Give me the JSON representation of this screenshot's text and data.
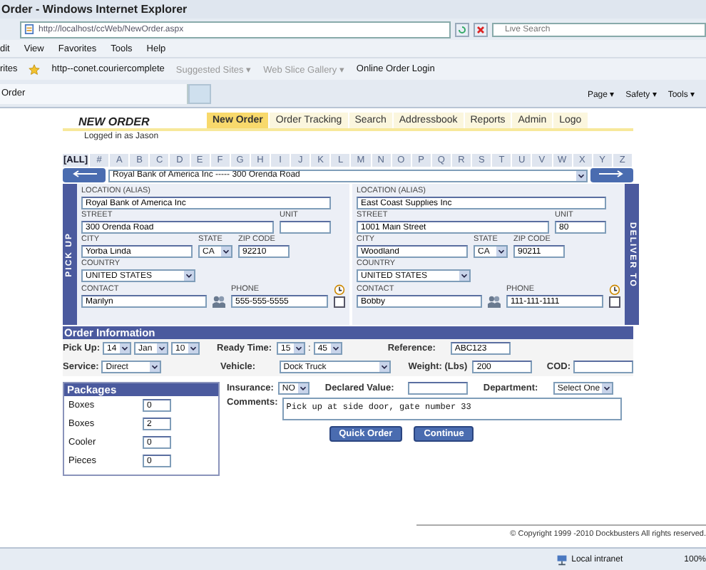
{
  "browser": {
    "title": "Order - Windows Internet Explorer",
    "address": "http://localhost/ccWeb/NewOrder.aspx",
    "search_placeholder": "Live Search",
    "menu": [
      "dit",
      "View",
      "Favorites",
      "Tools",
      "Help"
    ],
    "favorites_label": "rites",
    "favorites": [
      {
        "label": "http--conet.couriercomplete",
        "dimmed": false
      },
      {
        "label": "Suggested Sites ▾",
        "dimmed": true
      },
      {
        "label": "Web Slice Gallery ▾",
        "dimmed": true
      },
      {
        "label": "Online Order Login",
        "dimmed": false
      }
    ],
    "tab": "Order",
    "commands": [
      "Page ▾",
      "Safety ▾",
      "Tools ▾"
    ]
  },
  "page": {
    "title": "NEW ORDER",
    "logged_in": "Logged in as Jason",
    "nav": [
      {
        "label": "New Order",
        "selected": true
      },
      {
        "label": "Order Tracking",
        "selected": false
      },
      {
        "label": "Search",
        "selected": false
      },
      {
        "label": "Addressbook",
        "selected": false
      },
      {
        "label": "Reports",
        "selected": false
      },
      {
        "label": "Admin",
        "selected": false
      },
      {
        "label": "Logo",
        "selected": false
      }
    ],
    "letters": [
      {
        "label": "[ALL]",
        "selected": true
      },
      {
        "label": "#",
        "selected": false
      },
      {
        "label": "A",
        "selected": false
      },
      {
        "label": "B",
        "selected": false
      },
      {
        "label": "C",
        "selected": false
      },
      {
        "label": "D",
        "selected": false
      },
      {
        "label": "E",
        "selected": false
      },
      {
        "label": "F",
        "selected": false
      },
      {
        "label": "G",
        "selected": false
      },
      {
        "label": "H",
        "selected": false
      },
      {
        "label": "I",
        "selected": false
      },
      {
        "label": "J",
        "selected": false
      },
      {
        "label": "K",
        "selected": false
      },
      {
        "label": "L",
        "selected": false
      },
      {
        "label": "M",
        "selected": false
      },
      {
        "label": "N",
        "selected": false
      },
      {
        "label": "O",
        "selected": false
      },
      {
        "label": "P",
        "selected": false
      },
      {
        "label": "Q",
        "selected": false
      },
      {
        "label": "R",
        "selected": false
      },
      {
        "label": "S",
        "selected": false
      },
      {
        "label": "T",
        "selected": false
      },
      {
        "label": "U",
        "selected": false
      },
      {
        "label": "V",
        "selected": false
      },
      {
        "label": "W",
        "selected": false
      },
      {
        "label": "X",
        "selected": false
      },
      {
        "label": "Y",
        "selected": false
      },
      {
        "label": "Z",
        "selected": false
      }
    ],
    "address_select": "Royal Bank of America Inc ----- 300 Orenda Road"
  },
  "pickup": {
    "side_label": "PICK UP",
    "location": {
      "label": "LOCATION (ALIAS)",
      "value": "Royal Bank of America Inc"
    },
    "street": {
      "label": "STREET",
      "value": "300 Orenda Road"
    },
    "unit": {
      "label": "UNIT"
    },
    "city": {
      "label": "CITY",
      "value": "Yorba Linda"
    },
    "state": {
      "label": "STATE",
      "value": "CA"
    },
    "zip": {
      "label": "ZIP CODE",
      "value": "92210"
    },
    "country": {
      "label": "COUNTRY",
      "value": "UNITED STATES"
    },
    "contact": {
      "label": "CONTACT",
      "value": "Marilyn"
    },
    "phone": {
      "label": "PHONE",
      "value": "555-555-5555"
    },
    "notify_checked": false
  },
  "deliver": {
    "side_label": "DELIVER TO",
    "location": {
      "label": "LOCATION (ALIAS)",
      "value": "East Coast Supplies Inc"
    },
    "street": {
      "label": "STREET",
      "value": "1001 Main Street"
    },
    "unit": {
      "label": "UNIT",
      "value": "80"
    },
    "city": {
      "label": "CITY",
      "value": "Woodland"
    },
    "state": {
      "label": "STATE",
      "value": "CA"
    },
    "zip": {
      "label": "ZIP CODE",
      "value": "90211"
    },
    "country": {
      "label": "COUNTRY",
      "value": "UNITED STATES"
    },
    "contact": {
      "label": "CONTACT",
      "value": "Bobby"
    },
    "phone": {
      "label": "PHONE",
      "value": "111-111-1111"
    },
    "notify_checked": false
  },
  "order_info": {
    "title": "Order Information",
    "pickup_label": "Pick Up:",
    "pickup_day": "14",
    "pickup_month": "Jan",
    "pickup_year": "10",
    "ready_label": "Ready Time:",
    "ready_hour": "15",
    "ready_sep": ":",
    "ready_min": "45",
    "reference_label": "Reference:",
    "reference": "ABC123",
    "service_label": "Service:",
    "service": "Direct",
    "vehicle_label": "Vehicle:",
    "vehicle": "Dock Truck",
    "weight_label": "Weight: (Lbs)",
    "weight": "200",
    "cod_label": "COD:"
  },
  "packages": {
    "title": "Packages",
    "items": [
      {
        "label": "Boxes",
        "value": "0"
      },
      {
        "label": "Boxes",
        "value": "2"
      },
      {
        "label": "Cooler",
        "value": "0"
      },
      {
        "label": "Pieces",
        "value": "0"
      }
    ]
  },
  "extras": {
    "insurance_label": "Insurance:",
    "insurance": "NO",
    "declared_label": "Declared Value:",
    "department_label": "Department:",
    "department": "Select One",
    "comments_label": "Comments:",
    "comments": "Pick up at side door, gate number 33"
  },
  "buttons": [
    "Quick Order",
    "Continue"
  ],
  "copyright": "© Copyright 1999 -2010 Dockbusters All rights reserved.",
  "status": {
    "zone": "Local intranet",
    "zoom": "100%"
  }
}
